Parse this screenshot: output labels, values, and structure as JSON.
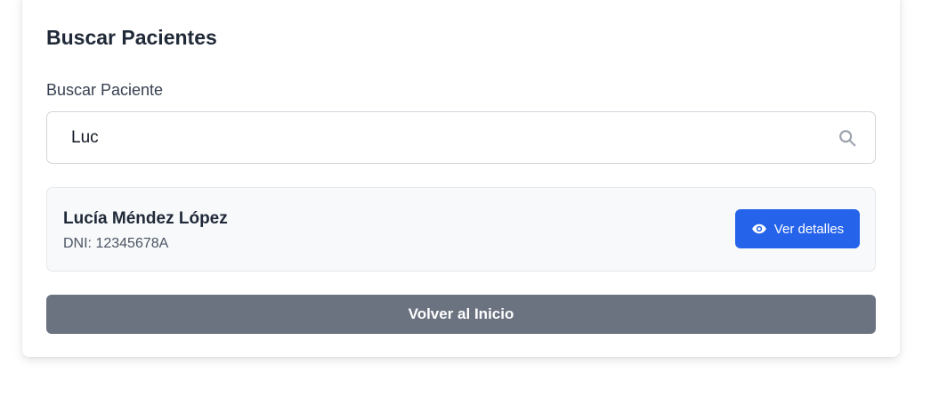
{
  "page": {
    "title": "Buscar Pacientes"
  },
  "search": {
    "label": "Buscar Paciente",
    "value": "Luc",
    "icon": "search-icon"
  },
  "results": [
    {
      "name": "Lucía Méndez López",
      "dni": "DNI: 12345678A",
      "action_label": "Ver detalles",
      "action_icon": "eye-icon"
    }
  ],
  "footer": {
    "back_label": "Volver al Inicio"
  },
  "colors": {
    "primary": "#2563eb",
    "secondary": "#6b7280",
    "result_bg": "#f8f9fb"
  }
}
